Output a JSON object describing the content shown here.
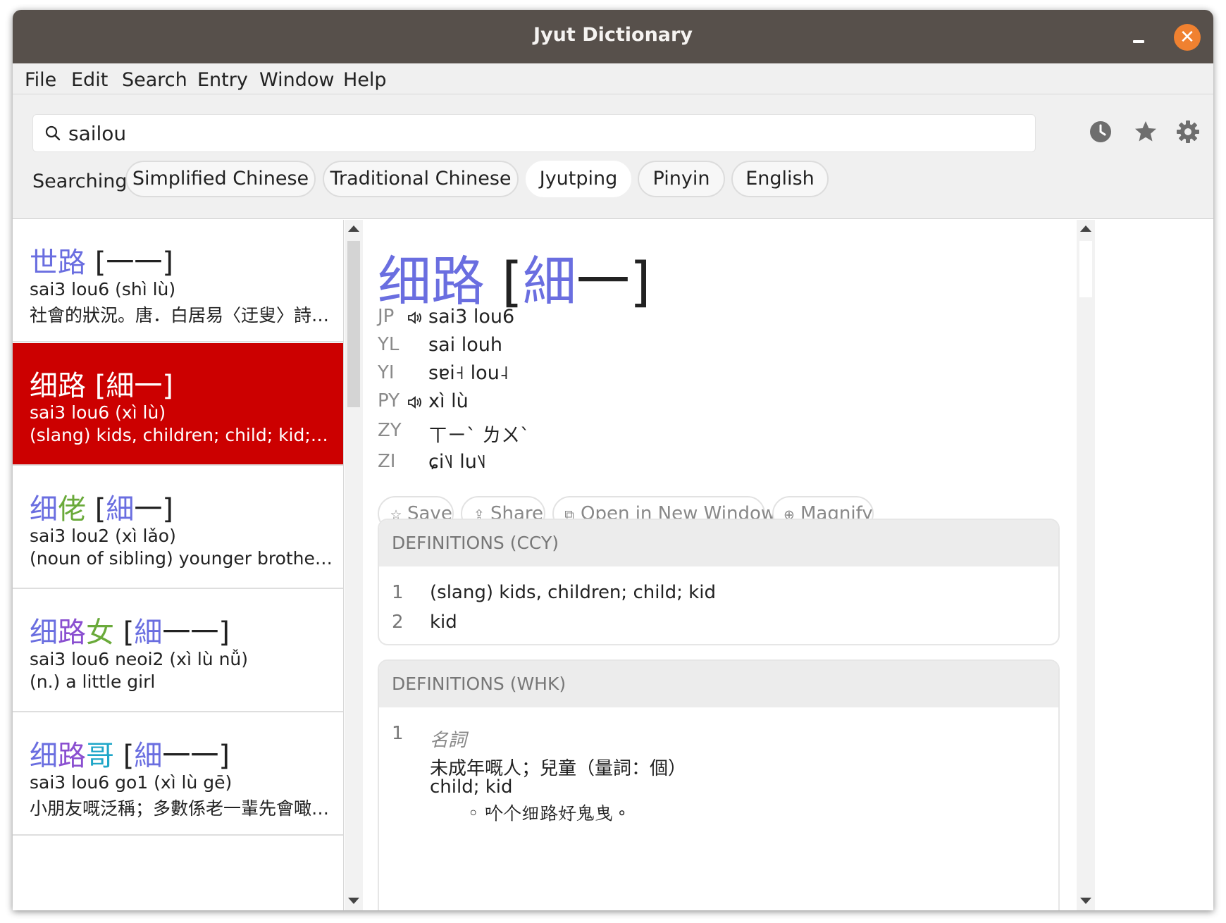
{
  "window": {
    "title": "Jyut Dictionary"
  },
  "menu": [
    "File",
    "Edit",
    "Search",
    "Entry",
    "Window",
    "Help"
  ],
  "search": {
    "value": "sailou",
    "placeholder": ""
  },
  "searching": {
    "label": "Searching:",
    "options": [
      "Simplified Chinese",
      "Traditional Chinese",
      "Jyutping",
      "Pinyin",
      "English"
    ],
    "active": "Jyutping"
  },
  "colors": {
    "tone1": "#3f7fd9",
    "tone2": "#6aaa3a",
    "tone3": "#6a6ee0",
    "tone6": "#8a4fd0",
    "tone1b": "#1fa6c8",
    "selected": "#cc0000"
  },
  "results": [
    {
      "simp": "世路",
      "trad": "[一一]",
      "pron": "sai3 lou6 (shì lù)",
      "def": "社會的狀況。唐．白居易〈迂叟〉詩：...",
      "selected": false
    },
    {
      "simp": "细路",
      "trad": "[細一]",
      "pron": "sai3 lou6 (xì lù)",
      "def": "(slang) kids, children; child; kid; kid",
      "selected": true
    },
    {
      "simp": "细佬",
      "trad": "[細一]",
      "pron": "sai3 lou2 (xì lǎo)",
      "def": "(noun of sibling) younger brother;...",
      "selected": false
    },
    {
      "simp": "细路女",
      "trad": "[細一一]",
      "pron": "sai3 lou6 neoi2 (xì lù nǚ)",
      "def": "(n.) a little girl",
      "selected": false
    },
    {
      "simp": "细路哥",
      "trad": "[細一一]",
      "pron": "sai3 lou6 go1 (xì lù gē)",
      "def": "小朋友嘅泛稱；多數係老一輩先會噉叫...",
      "selected": false
    }
  ],
  "entry": {
    "simp": "细路",
    "trad_open": "[",
    "trad_chars": "細",
    "trad_rest": "一",
    "trad_close": "]",
    "pronunciations": [
      {
        "label": "JP",
        "value": "sai3 lou6",
        "speaker": true
      },
      {
        "label": "YL",
        "value": "sai louh",
        "speaker": false
      },
      {
        "label": "YI",
        "value": "sɐi˧ lou˨",
        "speaker": false
      },
      {
        "label": "PY",
        "value": "xì lù",
        "speaker": true
      },
      {
        "label": "ZY",
        "value": "ㄒㄧˋ ㄌㄨˋ",
        "speaker": false
      },
      {
        "label": "ZI",
        "value": "ɕi˥˩ lu˥˩",
        "speaker": false
      }
    ],
    "actions": [
      {
        "label": "Save",
        "icon": "star-outline-icon",
        "glyph": "☆"
      },
      {
        "label": "Share",
        "icon": "share-icon",
        "glyph": "⇪"
      },
      {
        "label": "Open in New Window",
        "icon": "external-window-icon",
        "glyph": "⧉"
      },
      {
        "label": "Magnify",
        "icon": "magnify-icon",
        "glyph": "⊕"
      }
    ],
    "sources": [
      {
        "title": "DEFINITIONS (CCY)",
        "definitions": [
          {
            "num": "1",
            "text": "(slang) kids, children; child; kid"
          },
          {
            "num": "2",
            "text": "kid"
          }
        ]
      },
      {
        "title": "DEFINITIONS (WHK)",
        "definitions": [
          {
            "num": "1",
            "pos": "名詞",
            "text_zh": "未成年嘅人；兒童（量詞：個）",
            "text_en": "child; kid",
            "example": "◦ 𠮶个细路好鬼曳。"
          }
        ]
      }
    ]
  }
}
